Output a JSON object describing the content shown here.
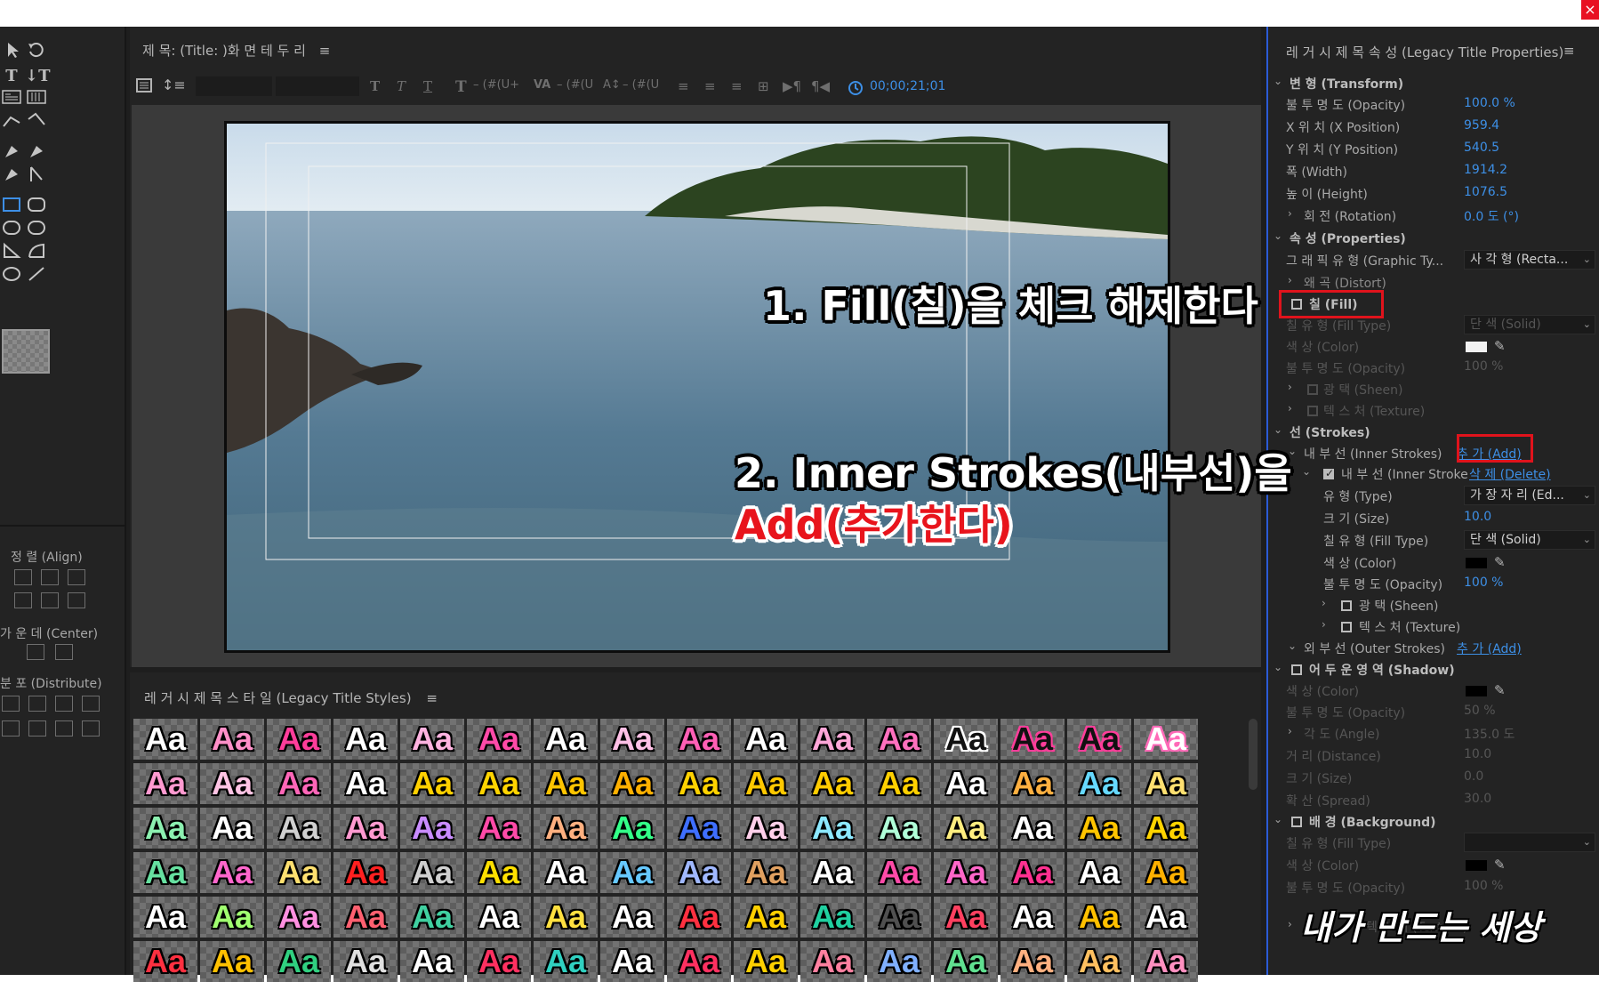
{
  "window": {
    "close_label": "×"
  },
  "designer": {
    "title": "제 목:  (Title: )화 면 테 두 리",
    "menu": "≡",
    "toolbar": {
      "kerning_label": "– (#(U+",
      "leading_label": "– (#(U",
      "baseline_label": "– (#(U",
      "timecode": "00;00;21;01"
    }
  },
  "tools": {
    "align": {
      "label": "정 렬 (Align)"
    },
    "center": {
      "label": "가 운 데 (Center)"
    },
    "distribute": {
      "label": "분 포 (Distribute)"
    }
  },
  "styles": {
    "title": "레 거 시 제 목 스 타 일 (Legacy Title Styles)",
    "menu": "≡",
    "swatch_text": "Aa"
  },
  "props": {
    "title": "레 거 시 제 목 속 성 (Legacy Title Properties)",
    "menu": "≡",
    "transform": {
      "label": "변 형 (Transform)"
    },
    "opacity": {
      "label": "불 투 명 도 (Opacity)",
      "value": "100.0 %"
    },
    "xpos": {
      "label": "X 위 치 (X Position)",
      "value": "959.4"
    },
    "ypos": {
      "label": "Y 위 치 (Y Position)",
      "value": "540.5"
    },
    "width": {
      "label": "폭 (Width)",
      "value": "1914.2"
    },
    "height": {
      "label": "높 이 (Height)",
      "value": "1076.5"
    },
    "rotation": {
      "label": "회 전 (Rotation)",
      "value": "0.0 도 (°)"
    },
    "properties": {
      "label": "속 성 (Properties)"
    },
    "graphic_type": {
      "label": "그 래 픽 유 형 (Graphic Ty...",
      "value": "사 각 형 (Recta..."
    },
    "distort": {
      "label": "왜 곡 (Distort)"
    },
    "fill": {
      "label": "칠 (Fill)"
    },
    "fill_type": {
      "label": "칠 유 형 (Fill Type)",
      "value": "단 색 (Solid)"
    },
    "fill_color": {
      "label": "색 상 (Color)",
      "swatch": "#f2f2f2"
    },
    "fill_opacity": {
      "label": "불 투 명 도 (Opacity)",
      "value": "100 %"
    },
    "sheen": {
      "label": "광 택 (Sheen)"
    },
    "texture": {
      "label": "텍 스 처 (Texture)"
    },
    "strokes": {
      "label": "선 (Strokes)"
    },
    "inner_strokes": {
      "label": "내 부 선 (Inner Strokes)",
      "add": "추 가 (Add)"
    },
    "inner_stroke": {
      "label": "내 부 선 (Inner Stroke)",
      "delete": "삭 제 (Delete)"
    },
    "stroke_type": {
      "label": "유 형 (Type)",
      "value": "가 장 자 리 (Ed..."
    },
    "stroke_size": {
      "label": "크 기 (Size)",
      "value": "10.0"
    },
    "stroke_fill_type": {
      "label": "칠 유 형 (Fill Type)",
      "value": "단 색 (Solid)"
    },
    "stroke_color": {
      "label": "색 상 (Color)",
      "swatch": "#000000"
    },
    "stroke_opacity": {
      "label": "불 투 명 도 (Opacity)",
      "value": "100 %"
    },
    "stroke_sheen": {
      "label": "광 택 (Sheen)"
    },
    "stroke_texture": {
      "label": "텍 스 처 (Texture)"
    },
    "outer_strokes": {
      "label": "외 부 선 (Outer Strokes)",
      "add": "추 가 (Add)"
    },
    "shadow": {
      "label": "어 두 운 영 역 (Shadow)"
    },
    "shadow_color": {
      "label": "색 상 (Color)",
      "swatch": "#000000"
    },
    "shadow_opacity": {
      "label": "불 투 명 도 (Opacity)",
      "value": "50 %"
    },
    "shadow_angle": {
      "label": "각 도 (Angle)",
      "value": "135.0 도"
    },
    "shadow_distance": {
      "label": "거 리 (Distance)",
      "value": "10.0"
    },
    "shadow_size": {
      "label": "크 기 (Size)",
      "value": "0.0"
    },
    "shadow_spread": {
      "label": "확 산 (Spread)",
      "value": "30.0"
    },
    "background": {
      "label": "배 경 (Background)"
    },
    "bg_fill_type": {
      "label": "칠 유 형 (Fill Type)"
    },
    "bg_color": {
      "label": "색 상 (Color)",
      "swatch": "#000000"
    },
    "bg_opacity": {
      "label": "불 투 명 도 (Opacity)",
      "value": "100 %"
    },
    "bg_texture": {
      "label": "텍 스 처 (Texture)"
    }
  },
  "annotations": {
    "step1": "1. Fill(칠)을 체크 해제한다",
    "step2_line1": "2. Inner Strokes(내부선)을",
    "step2_line2": "Add(추가한다)",
    "watermark": "내가 만드는 세상"
  },
  "colors": {
    "accent": "#3d8fe6",
    "highlight": "#e0131c",
    "panel": "#232323"
  }
}
